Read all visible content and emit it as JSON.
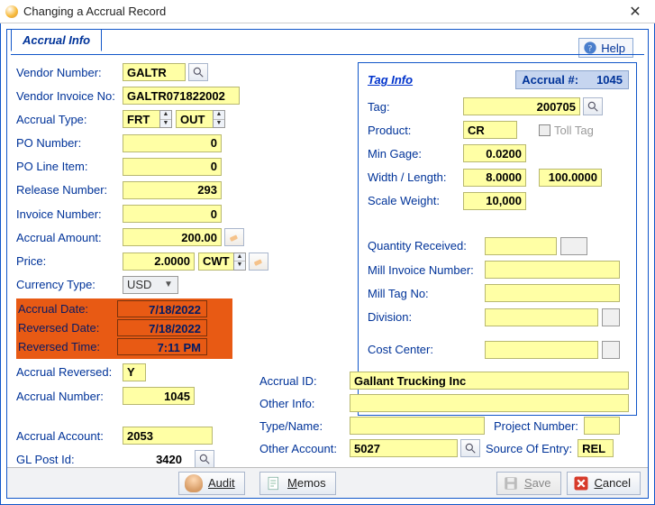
{
  "window": {
    "title": "Changing a Accrual Record"
  },
  "help_label": "Help",
  "tab_label": "Accrual Info",
  "left": {
    "vendor_number_label": "Vendor Number:",
    "vendor_number": "GALTR",
    "vendor_invoice_no_label": "Vendor Invoice No:",
    "vendor_invoice_no": "GALTR071822002",
    "accrual_type_label": "Accrual Type:",
    "accrual_type_a": "FRT",
    "accrual_type_b": "OUT",
    "po_number_label": "PO Number:",
    "po_number": "0",
    "po_line_item_label": "PO Line Item:",
    "po_line_item": "0",
    "release_number_label": "Release Number:",
    "release_number": "293",
    "invoice_number_label": "Invoice Number:",
    "invoice_number": "0",
    "accrual_amount_label": "Accrual Amount:",
    "accrual_amount": "200.00",
    "price_label": "Price:",
    "price": "2.0000",
    "price_unit": "CWT",
    "currency_type_label": "Currency Type:",
    "currency_type": "USD",
    "accrual_date_label": "Accrual Date:",
    "accrual_date": "7/18/2022",
    "reversed_date_label": "Reversed Date:",
    "reversed_date": "7/18/2022",
    "reversed_time_label": "Reversed Time:",
    "reversed_time": "7:11 PM",
    "accrual_reversed_label": "Accrual Reversed:",
    "accrual_reversed": "Y",
    "accrual_number_label": "Accrual Number:",
    "accrual_number": "1045",
    "accrual_account_label": "Accrual Account:",
    "accrual_account": "2053",
    "gl_post_id_label": "GL Post Id:",
    "gl_post_id": "3420"
  },
  "right": {
    "tag_info_label": "Tag Info",
    "accrual_num_label": "Accrual #:",
    "accrual_num": "1045",
    "tag_label": "Tag:",
    "tag": "200705",
    "product_label": "Product:",
    "product": "CR",
    "toll_tag_label": "Toll Tag",
    "min_gage_label": "Min Gage:",
    "min_gage": "0.0200",
    "width_length_label": "Width / Length:",
    "width": "8.0000",
    "length": "100.0000",
    "scale_weight_label": "Scale Weight:",
    "scale_weight": "10,000",
    "qty_received_label": "Quantity Received:",
    "qty_received": "",
    "mill_invoice_label": "Mill Invoice Number:",
    "mill_invoice": "",
    "mill_tag_label": "Mill Tag No:",
    "mill_tag": "",
    "division_label": "Division:",
    "division": "",
    "cost_center_label": "Cost Center:",
    "cost_center": ""
  },
  "bottom": {
    "accrual_id_label": "Accrual ID:",
    "accrual_id": "Gallant Trucking Inc",
    "other_info_label": "Other Info:",
    "other_info": "",
    "type_name_label": "Type/Name:",
    "type_name": "",
    "project_number_label": "Project Number:",
    "project_number": "",
    "other_account_label": "Other Account:",
    "other_account": "5027",
    "source_entry_label": "Source Of Entry:",
    "source_entry": "REL"
  },
  "toolbar": {
    "audit": "Audit",
    "memos": "Memos",
    "save": "Save",
    "cancel": "Cancel"
  }
}
